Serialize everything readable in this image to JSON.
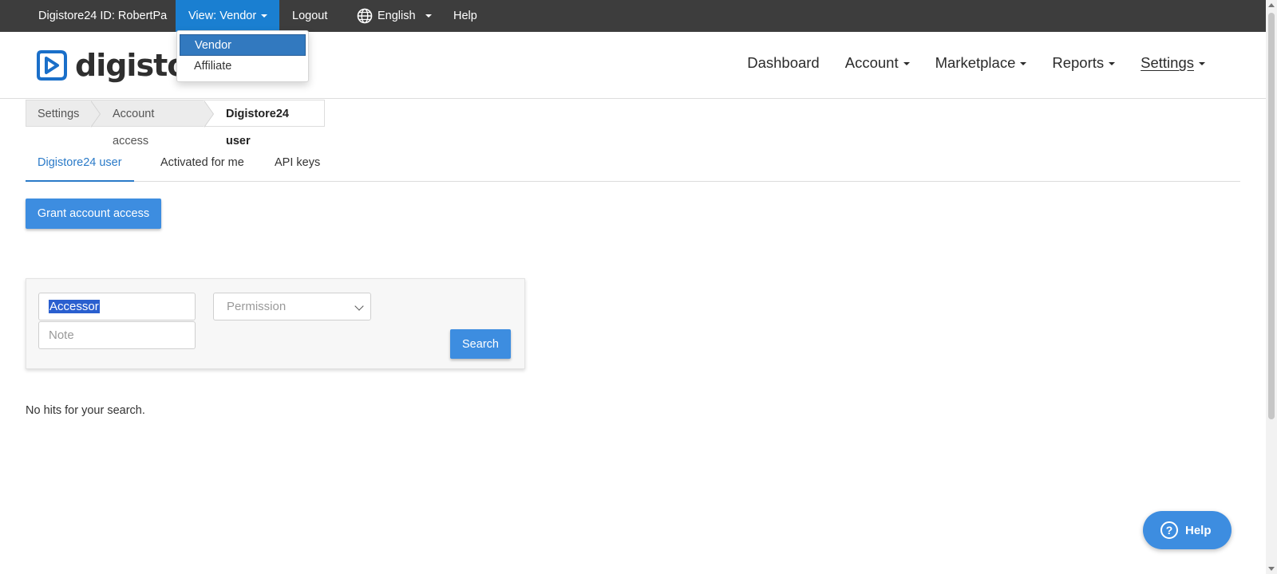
{
  "topbar": {
    "id_label": "Digistore24 ID: RobertPa",
    "view_label": "View: Vendor",
    "logout_label": "Logout",
    "language_label": "English",
    "help_label": "Help"
  },
  "view_dropdown": {
    "options": [
      "Vendor",
      "Affiliate"
    ],
    "selected": "Vendor"
  },
  "logo": {
    "text": "digistore",
    "brand_color": "#1a6fc9"
  },
  "main_nav": {
    "items": [
      "Dashboard",
      "Account",
      "Marketplace",
      "Reports",
      "Settings"
    ]
  },
  "breadcrumb": {
    "items": [
      "Settings",
      "Account access",
      "Digistore24 user"
    ]
  },
  "tabs": {
    "items": [
      "Digistore24 user",
      "Activated for me",
      "API keys"
    ],
    "active": "Digistore24 user"
  },
  "grant_button": {
    "label": "Grant account access"
  },
  "filter": {
    "accessor_value": "Accessor",
    "note_placeholder": "Note",
    "permission_placeholder": "Permission",
    "search_label": "Search"
  },
  "results": {
    "message": "No hits for your search."
  },
  "help_float": {
    "label": "Help"
  },
  "colors": {
    "accent": "#3d8de0",
    "topbar": "#3d3d3d",
    "view_active": "#1a7fd1"
  }
}
